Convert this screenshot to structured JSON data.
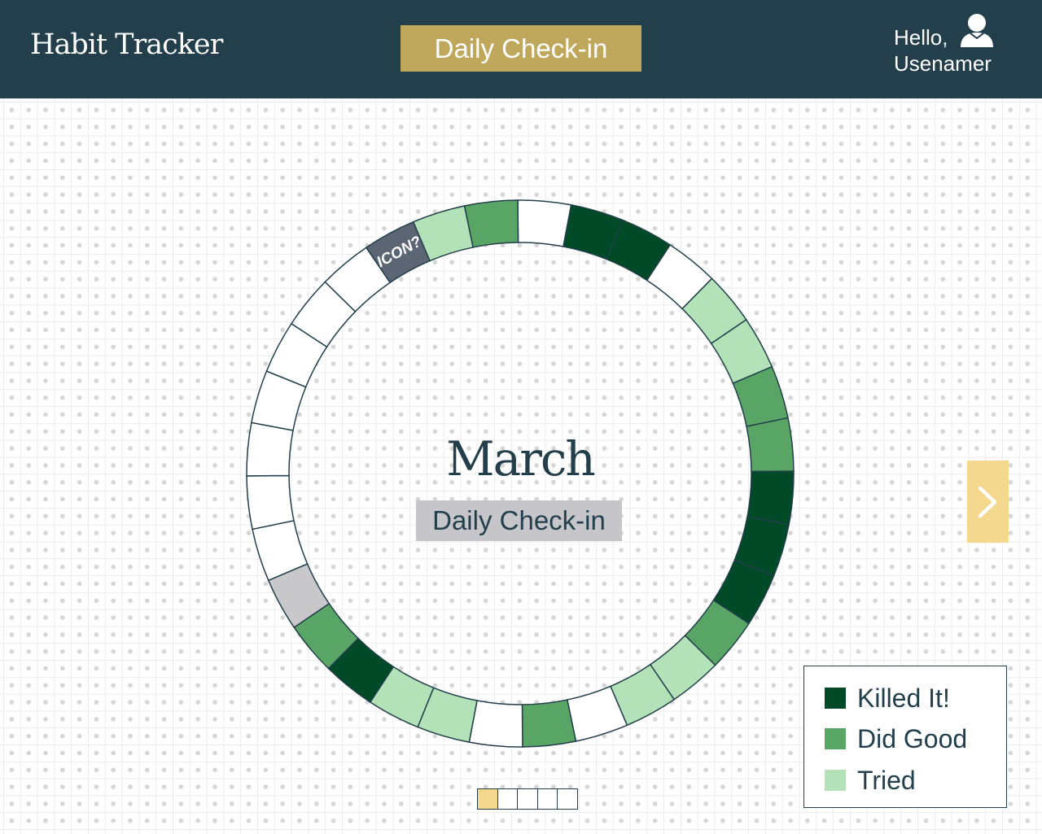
{
  "header": {
    "app_title": "Habit Tracker",
    "nav_button": "Daily Check-in",
    "greeting_line1": "Hello,",
    "greeting_line2": "Usenamer",
    "user_icon": "user-icon"
  },
  "main": {
    "month": "March",
    "habit_label": "Daily Check-in",
    "ring_icon_label": "ICON?",
    "next_icon": "chevron-right-icon"
  },
  "colors": {
    "header_bg": "#223f4b",
    "accent": "#bfa85c",
    "killed": "#004a27",
    "good": "#59a565",
    "tried": "#b3e2b8",
    "empty": "#ffffff",
    "inactive": "#c8c8ca",
    "icon_segment": "#5b6574",
    "next_button": "#f4d88e"
  },
  "ring": {
    "segments": [
      "white",
      "killed",
      "killed",
      "white",
      "tried",
      "tried",
      "good",
      "good",
      "killed",
      "killed",
      "killed",
      "good",
      "tried",
      "tried",
      "white",
      "good",
      "white",
      "tried",
      "tried",
      "killed",
      "good",
      "inactive",
      "white",
      "white",
      "white",
      "white",
      "white",
      "white",
      "white",
      "icon",
      "tried",
      "good"
    ]
  },
  "legend": [
    {
      "label": "Killed It!",
      "status": "killed"
    },
    {
      "label": "Did Good",
      "status": "good"
    },
    {
      "label": "Tried",
      "status": "tried"
    }
  ],
  "pager": {
    "pages": 5,
    "current": 1
  }
}
